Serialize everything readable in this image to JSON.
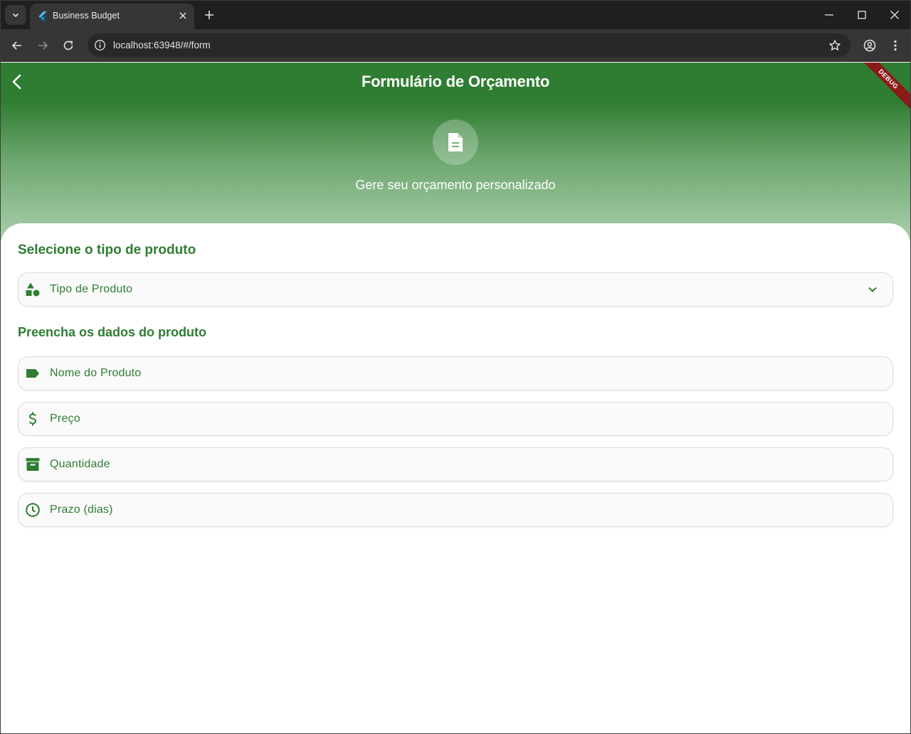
{
  "browser": {
    "tab_title": "Business Budget",
    "url": "localhost:63948/#/form"
  },
  "app": {
    "title": "Formulário de Orçamento",
    "subtitle": "Gere seu orçamento personalizado",
    "debug_banner": "DEBUG",
    "section_product_type": "Selecione o tipo de produto",
    "product_type_dropdown": {
      "label": "Tipo de Produto",
      "icon": "category-icon"
    },
    "section_product_data": "Preencha os dados do produto",
    "fields": [
      {
        "label": "Nome do Produto",
        "icon": "label-icon"
      },
      {
        "label": "Preço",
        "icon": "dollar-icon"
      },
      {
        "label": "Quantidade",
        "icon": "inventory-box-icon"
      },
      {
        "label": "Prazo (dias)",
        "icon": "clock-icon"
      }
    ]
  },
  "colors": {
    "primary": "#2e7d32",
    "field_background": "#fafafa",
    "debug_banner": "#8b1a1a",
    "browser_frame": "#1f1f1f"
  }
}
